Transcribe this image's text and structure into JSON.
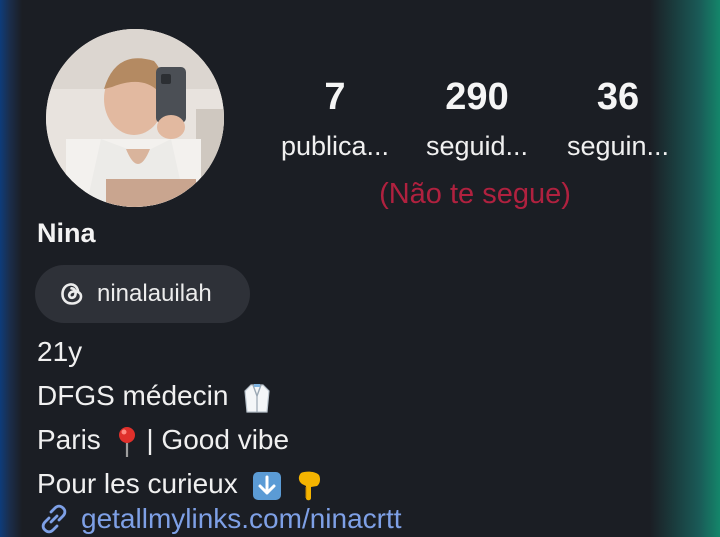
{
  "profile": {
    "name": "Nina",
    "stats": [
      {
        "value": "7",
        "label": "publica..."
      },
      {
        "value": "290",
        "label": "seguid..."
      },
      {
        "value": "36",
        "label": "seguin..."
      }
    ],
    "follows_note": "(Não te segue)",
    "threads_handle": "ninalauilah",
    "bio": [
      "21y",
      "DFGS médecin",
      "Paris",
      "| Good vibe",
      "Pour les curieux"
    ],
    "link": "getallmylinks.com/ninacrtt"
  },
  "colors": {
    "background": "#1b1e24",
    "follows_note": "#b0213f",
    "link": "#7ea0e6",
    "chip": "#2e3138"
  },
  "icons": [
    "threads-icon",
    "lab-coat-emoji",
    "pin-emoji",
    "down-arrow-emoji",
    "pointing-down-emoji",
    "link-chain-icon"
  ]
}
